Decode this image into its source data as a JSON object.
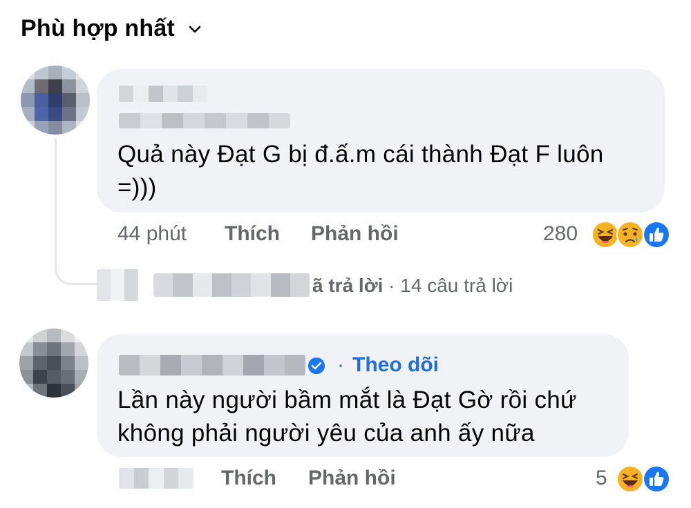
{
  "sort": {
    "label": "Phù hợp nhất",
    "icon": "chevron-down-icon"
  },
  "comments": [
    {
      "author_blurred": true,
      "text": "Quả này Đạt G bị đ.ấ.m cái thành Đạt F luôn =)))",
      "text_line1": "Quả này Đạt G bị đ.ấ.m cái thành Đạt F luôn",
      "text_line2": "=)))",
      "time": "44 phút",
      "like_label": "Thích",
      "reply_label": "Phản hồi",
      "reaction_count": "280",
      "reactions": [
        "haha-icon",
        "sad-icon",
        "like-icon"
      ],
      "replies_summary": {
        "suffix": "ã trả lời",
        "separator": "·",
        "count_text": "14 câu trả lời"
      }
    },
    {
      "author_blurred": true,
      "verified": true,
      "follow_separator": "·",
      "follow_label": "Theo dõi",
      "text_line1": "Lần này người bầm mắt là Đạt Gờ rồi chứ",
      "text_line2": "không phải người yêu của anh ấy nữa",
      "like_label": "Thích",
      "reply_label": "Phản hồi",
      "reaction_count": "5",
      "reactions": [
        "haha-icon",
        "like-icon"
      ]
    }
  ],
  "colors": {
    "bubble": "#f0f2f5",
    "meta": "#65676b",
    "link": "#216fdb",
    "like_blue": "#1877f2",
    "haha_yellow": "#f7b125"
  }
}
